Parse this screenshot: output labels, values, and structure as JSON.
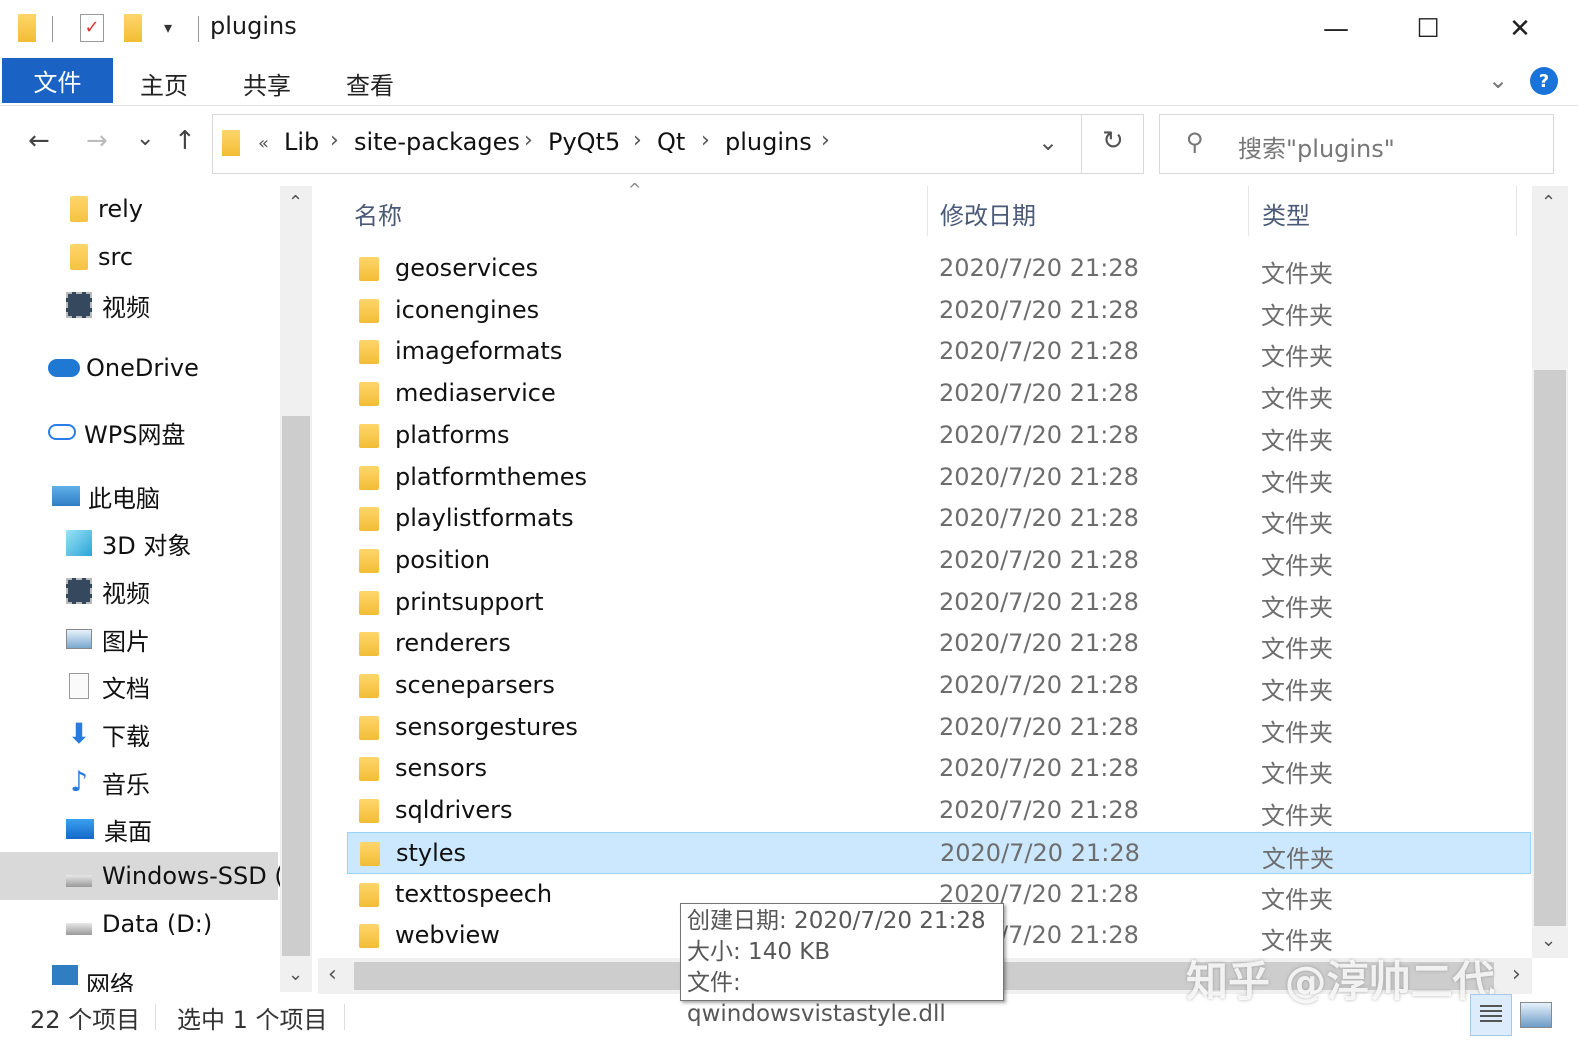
{
  "window": {
    "title": "plugins",
    "controls": {
      "minimize": "—",
      "maximize": "☐",
      "close": "✕"
    }
  },
  "ribbon": {
    "tabs": [
      "文件",
      "主页",
      "共享",
      "查看"
    ],
    "help": "?"
  },
  "nav": {
    "back": "←",
    "forward": "→",
    "recent": "⌄",
    "up": "↑",
    "overflow": "«",
    "breadcrumb": [
      "Lib",
      "site-packages",
      "PyQt5",
      "Qt",
      "plugins"
    ],
    "refresh": "↻",
    "search_placeholder": "搜索\"plugins\""
  },
  "sidebar": {
    "items": [
      {
        "label": "rely",
        "icon": "folder-icon"
      },
      {
        "label": "src",
        "icon": "folder-icon"
      },
      {
        "label": "视频",
        "icon": "video-icon"
      },
      {
        "label": "OneDrive",
        "icon": "onedrive-icon"
      },
      {
        "label": "WPS网盘",
        "icon": "cloud-icon"
      },
      {
        "label": "此电脑",
        "icon": "computer-icon"
      },
      {
        "label": "3D 对象",
        "icon": "3d-objects-icon"
      },
      {
        "label": "视频",
        "icon": "video-icon"
      },
      {
        "label": "图片",
        "icon": "pictures-icon"
      },
      {
        "label": "文档",
        "icon": "documents-icon"
      },
      {
        "label": "下载",
        "icon": "download-icon"
      },
      {
        "label": "音乐",
        "icon": "music-icon"
      },
      {
        "label": "桌面",
        "icon": "desktop-icon"
      },
      {
        "label": "Windows-SSD (",
        "icon": "drive-icon"
      },
      {
        "label": "Data (D:)",
        "icon": "drive-icon"
      },
      {
        "label": "网络",
        "icon": "network-icon"
      }
    ]
  },
  "columns": {
    "name": "名称",
    "date": "修改日期",
    "type": "类型"
  },
  "files": [
    {
      "name": "geoservices",
      "date": "2020/7/20 21:28",
      "type": "文件夹"
    },
    {
      "name": "iconengines",
      "date": "2020/7/20 21:28",
      "type": "文件夹"
    },
    {
      "name": "imageformats",
      "date": "2020/7/20 21:28",
      "type": "文件夹"
    },
    {
      "name": "mediaservice",
      "date": "2020/7/20 21:28",
      "type": "文件夹"
    },
    {
      "name": "platforms",
      "date": "2020/7/20 21:28",
      "type": "文件夹"
    },
    {
      "name": "platformthemes",
      "date": "2020/7/20 21:28",
      "type": "文件夹"
    },
    {
      "name": "playlistformats",
      "date": "2020/7/20 21:28",
      "type": "文件夹"
    },
    {
      "name": "position",
      "date": "2020/7/20 21:28",
      "type": "文件夹"
    },
    {
      "name": "printsupport",
      "date": "2020/7/20 21:28",
      "type": "文件夹"
    },
    {
      "name": "renderers",
      "date": "2020/7/20 21:28",
      "type": "文件夹"
    },
    {
      "name": "sceneparsers",
      "date": "2020/7/20 21:28",
      "type": "文件夹"
    },
    {
      "name": "sensorgestures",
      "date": "2020/7/20 21:28",
      "type": "文件夹"
    },
    {
      "name": "sensors",
      "date": "2020/7/20 21:28",
      "type": "文件夹"
    },
    {
      "name": "sqldrivers",
      "date": "2020/7/20 21:28",
      "type": "文件夹"
    },
    {
      "name": "styles",
      "date": "2020/7/20 21:28",
      "type": "文件夹",
      "selected": true
    },
    {
      "name": "texttospeech",
      "date": "2020/7/20 21:28",
      "type": "文件夹"
    },
    {
      "name": "webview",
      "date": "2020/7/20 21:28",
      "type": "文件夹"
    }
  ],
  "tooltip": {
    "created": "创建日期: 2020/7/20 21:28",
    "size": "大小: 140 KB",
    "files": "文件: qwindowsvistastyle.dll"
  },
  "status": {
    "count": "22 个项目",
    "selected": "选中 1 个项目"
  },
  "watermark": "知乎 @淳帅二代",
  "colors": {
    "accent": "#1a63c4",
    "selection": "#cce8ff",
    "selection_border": "#99d1ff"
  }
}
